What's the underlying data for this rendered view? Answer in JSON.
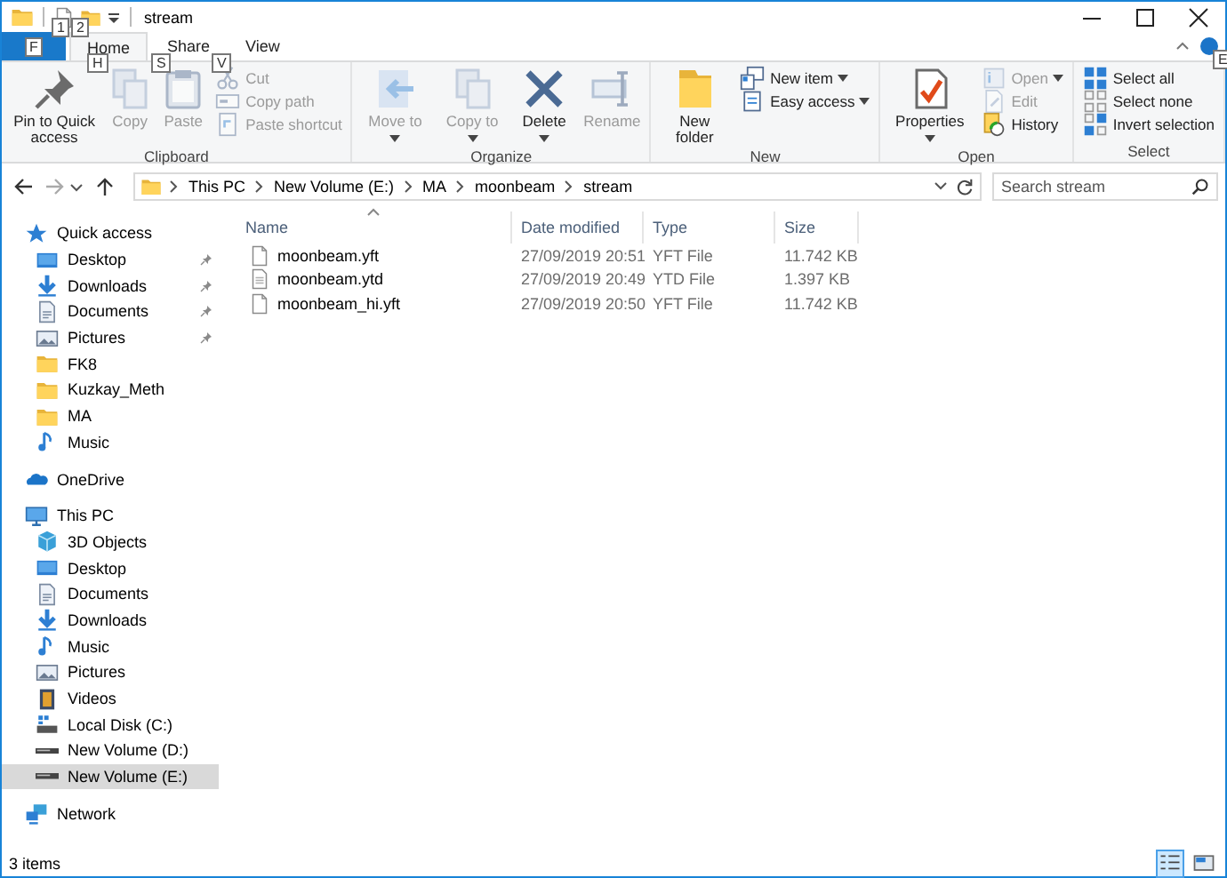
{
  "title_bar": {
    "title": "stream",
    "key_tips": [
      "1",
      "2"
    ]
  },
  "ribbon": {
    "tabs": [
      {
        "kind": "file",
        "key_tip": "F"
      },
      {
        "label": "Home",
        "kind": "tab",
        "selected": true,
        "key_tip": "H"
      },
      {
        "label": "Share",
        "kind": "tab",
        "selected": false,
        "key_tip": "S"
      },
      {
        "label": "View",
        "kind": "tab",
        "selected": false,
        "key_tip": "V"
      }
    ],
    "help_key_tip": "E",
    "groups": [
      {
        "label": "Clipboard",
        "items": [
          {
            "label": "Pin to Quick access",
            "kind": "large",
            "disabled": false,
            "dropdown": false
          },
          {
            "label": "Copy",
            "kind": "large",
            "disabled": true,
            "dropdown": false
          },
          {
            "label": "Paste",
            "kind": "large",
            "disabled": true,
            "dropdown": false
          },
          {
            "label": "Cut",
            "kind": "small",
            "disabled": true,
            "dropdown": false
          },
          {
            "label": "Copy path",
            "kind": "small",
            "disabled": true,
            "dropdown": false
          },
          {
            "label": "Paste shortcut",
            "kind": "small",
            "disabled": true,
            "dropdown": false
          }
        ]
      },
      {
        "label": "Organize",
        "items": [
          {
            "label": "Move to",
            "kind": "large",
            "disabled": true,
            "dropdown": true
          },
          {
            "label": "Copy to",
            "kind": "large",
            "disabled": true,
            "dropdown": true
          },
          {
            "label": "Delete",
            "kind": "large",
            "disabled": false,
            "dropdown": true
          },
          {
            "label": "Rename",
            "kind": "large",
            "disabled": true,
            "dropdown": false
          }
        ]
      },
      {
        "label": "New",
        "items": [
          {
            "label": "New folder",
            "kind": "large",
            "disabled": false,
            "dropdown": false
          },
          {
            "label": "New item",
            "kind": "small",
            "disabled": false,
            "dropdown": true
          },
          {
            "label": "Easy access",
            "kind": "small",
            "disabled": false,
            "dropdown": true
          }
        ]
      },
      {
        "label": "Open",
        "items": [
          {
            "label": "Properties",
            "kind": "large",
            "disabled": false,
            "dropdown": true
          },
          {
            "label": "Open",
            "kind": "small",
            "disabled": true,
            "dropdown": true
          },
          {
            "label": "Edit",
            "kind": "small",
            "disabled": true,
            "dropdown": false
          },
          {
            "label": "History",
            "kind": "small",
            "disabled": false,
            "dropdown": false
          }
        ]
      },
      {
        "label": "Select",
        "items": [
          {
            "label": "Select all",
            "kind": "small",
            "disabled": false,
            "dropdown": false
          },
          {
            "label": "Select none",
            "kind": "small",
            "disabled": false,
            "dropdown": false
          },
          {
            "label": "Invert selection",
            "kind": "small",
            "disabled": false,
            "dropdown": false
          }
        ]
      }
    ]
  },
  "address_bar": {
    "path": [
      "This PC",
      "New Volume (E:)",
      "MA",
      "moonbeam",
      "stream"
    ]
  },
  "search": {
    "placeholder": "Search stream"
  },
  "navigation": [
    {
      "label": "Quick access",
      "selected": false,
      "children": [
        {
          "label": "Desktop",
          "selected": false,
          "pinned": true
        },
        {
          "label": "Downloads",
          "selected": false,
          "pinned": true
        },
        {
          "label": "Documents",
          "selected": false,
          "pinned": true
        },
        {
          "label": "Pictures",
          "selected": false,
          "pinned": true
        },
        {
          "label": "FK8",
          "selected": false,
          "pinned": false
        },
        {
          "label": "Kuzkay_Meth",
          "selected": false,
          "pinned": false
        },
        {
          "label": "MA",
          "selected": false,
          "pinned": false
        },
        {
          "label": "Music",
          "selected": false,
          "pinned": false
        }
      ]
    },
    {
      "label": "OneDrive",
      "selected": false
    },
    {
      "label": "This PC",
      "selected": false,
      "children": [
        {
          "label": "3D Objects",
          "selected": false
        },
        {
          "label": "Desktop",
          "selected": false
        },
        {
          "label": "Documents",
          "selected": false
        },
        {
          "label": "Downloads",
          "selected": false
        },
        {
          "label": "Music",
          "selected": false
        },
        {
          "label": "Pictures",
          "selected": false
        },
        {
          "label": "Videos",
          "selected": false
        },
        {
          "label": "Local Disk (C:)",
          "selected": false
        },
        {
          "label": "New Volume (D:)",
          "selected": false
        },
        {
          "label": "New Volume (E:)",
          "selected": true
        }
      ]
    },
    {
      "label": "Network",
      "selected": false
    }
  ],
  "table": {
    "columns": [
      "Name",
      "Date modified",
      "Type",
      "Size"
    ],
    "rows": [
      {
        "name": "moonbeam.yft",
        "date": "27/09/2019 20:51",
        "type": "YFT File",
        "size": "11.742 KB"
      },
      {
        "name": "moonbeam.ytd",
        "date": "27/09/2019 20:49",
        "type": "YTD File",
        "size": "1.397 KB"
      },
      {
        "name": "moonbeam_hi.yft",
        "date": "27/09/2019 20:50",
        "type": "YFT File",
        "size": "11.742 KB"
      }
    ]
  },
  "status_bar": {
    "text": "3 items",
    "views": [
      {
        "kind": "details",
        "selected": true
      },
      {
        "kind": "large_icons",
        "selected": false
      }
    ]
  }
}
